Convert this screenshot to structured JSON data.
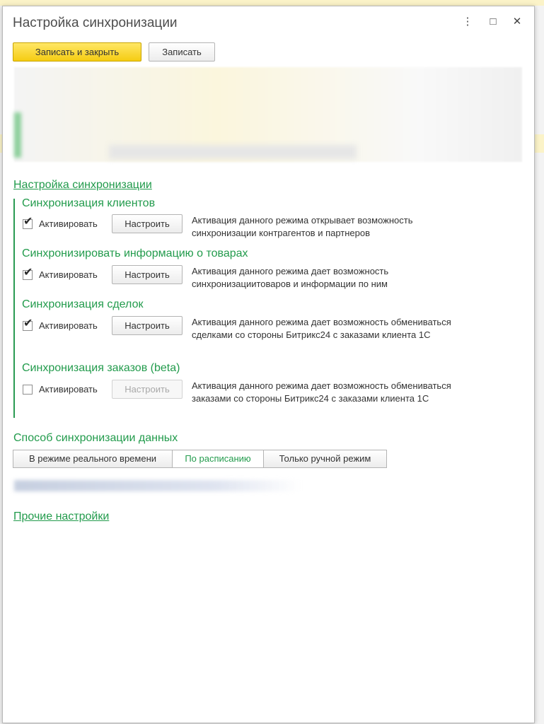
{
  "window": {
    "title": "Настройка синхронизации",
    "controls": {
      "more": "⋮",
      "maximize": "□",
      "close": "✕"
    }
  },
  "toolbar": {
    "save_close_label": "Записать и закрыть",
    "save_label": "Записать"
  },
  "sync_settings": {
    "header": "Настройка синхронизации",
    "sections": [
      {
        "title": "Синхронизация клиентов",
        "checked": true,
        "checkbox_label": "Активировать",
        "button_label": "Настроить",
        "button_enabled": true,
        "desc_line1": "Активация данного режима открывает возможность",
        "desc_line2": "синхронизации контрагентов и партнеров"
      },
      {
        "title": "Синхронизировать информацию о товарах",
        "checked": true,
        "checkbox_label": "Активировать",
        "button_label": "Настроить",
        "button_enabled": true,
        "desc_line1": "Активация данного режима дает возможность",
        "desc_line2": "синхронизациитоваров и информации по ним"
      },
      {
        "title": "Синхронизация сделок",
        "checked": true,
        "checkbox_label": "Активировать",
        "button_label": "Настроить",
        "button_enabled": true,
        "desc_line1": "Активация данного режима дает возможность обмениваться",
        "desc_line2": "сделками со стороны Битрикс24 с заказами клиента 1С"
      },
      {
        "title": "Синхронизация заказов (beta)",
        "checked": false,
        "checkbox_label": "Активировать",
        "button_label": "Настроить",
        "button_enabled": false,
        "desc_line1": "Активация данного режима дает возможность обмениваться",
        "desc_line2": "заказами со стороны Битрикс24 с заказами клиента 1С"
      }
    ]
  },
  "sync_mode": {
    "title": "Способ синхронизации данных",
    "options": [
      "В режиме реального времени",
      "По расписанию",
      "Только ручной режим"
    ],
    "selected": "По расписанию"
  },
  "other_settings": {
    "label": "Прочие настройки"
  },
  "colors": {
    "accent_green": "#229b4c",
    "primary_button": "#f5cc12"
  }
}
